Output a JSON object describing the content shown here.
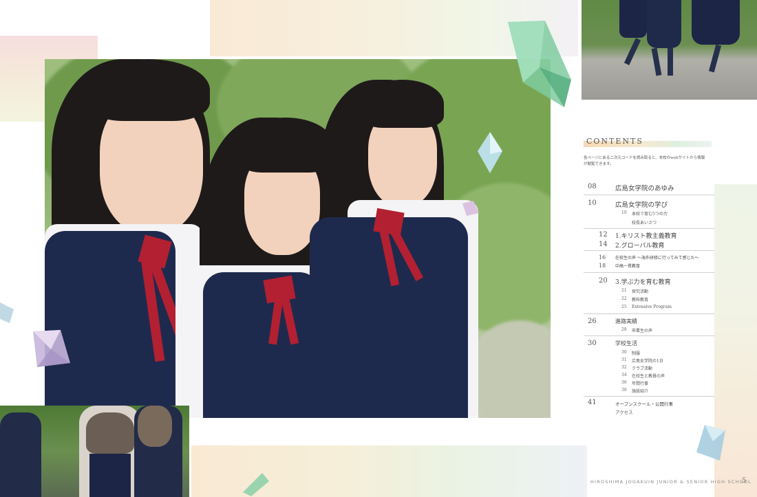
{
  "contents": {
    "heading": "CONTENTS",
    "note": "各ページにある二次元コードを読み取ると、本校のwebサイトから情報が閲覧できます。",
    "items": [
      {
        "num": "08",
        "title": "広島女学院のあゆみ",
        "subs": []
      },
      {
        "num": "10",
        "title": "広島女学院の学び",
        "subs": [
          {
            "num": "10",
            "title": "本校で育む5つの力"
          },
          {
            "num": "",
            "title": "校長あいさつ"
          }
        ]
      },
      {
        "num": "12",
        "title": "1.キリスト教主義教育",
        "subs": []
      },
      {
        "num": "14",
        "title": "2.グローバル教育",
        "subs": []
      },
      {
        "num": "16",
        "title": "在校生の声 ～海外研修に行ってみて感じた～",
        "subs": []
      },
      {
        "num": "18",
        "title": "中高一貫教育",
        "subs": []
      },
      {
        "num": "20",
        "title": "3.学ぶ力を育む教育",
        "subs": [
          {
            "num": "21",
            "title": "探究活動"
          },
          {
            "num": "22",
            "title": "教科教育"
          },
          {
            "num": "25",
            "title": "Extensive Program"
          }
        ]
      },
      {
        "num": "26",
        "title": "進路実績",
        "subs": [
          {
            "num": "28",
            "title": "卒業生の声"
          }
        ]
      },
      {
        "num": "30",
        "title": "学校生活",
        "subs": [
          {
            "num": "30",
            "title": "制服"
          },
          {
            "num": "31",
            "title": "広島女学院の1日"
          },
          {
            "num": "32",
            "title": "クラブ活動"
          },
          {
            "num": "34",
            "title": "在校生と教員の声"
          },
          {
            "num": "36",
            "title": "年間行事"
          },
          {
            "num": "38",
            "title": "施設紹介"
          }
        ]
      },
      {
        "num": "41",
        "title": "オープンスクール・公開行事",
        "subs": [
          {
            "num": "",
            "title": "アクセス"
          }
        ]
      }
    ]
  },
  "footer": {
    "school": "HIROSHIMA JOGAKUIN JUNIOR & SENIOR HIGH SCHOOL",
    "page": "5"
  },
  "colors": {
    "uniform_navy": "#1e2a4d",
    "ribbon_red": "#b32031",
    "accent_peach": "#f4cfa4",
    "accent_mint": "#d8ecd8"
  }
}
